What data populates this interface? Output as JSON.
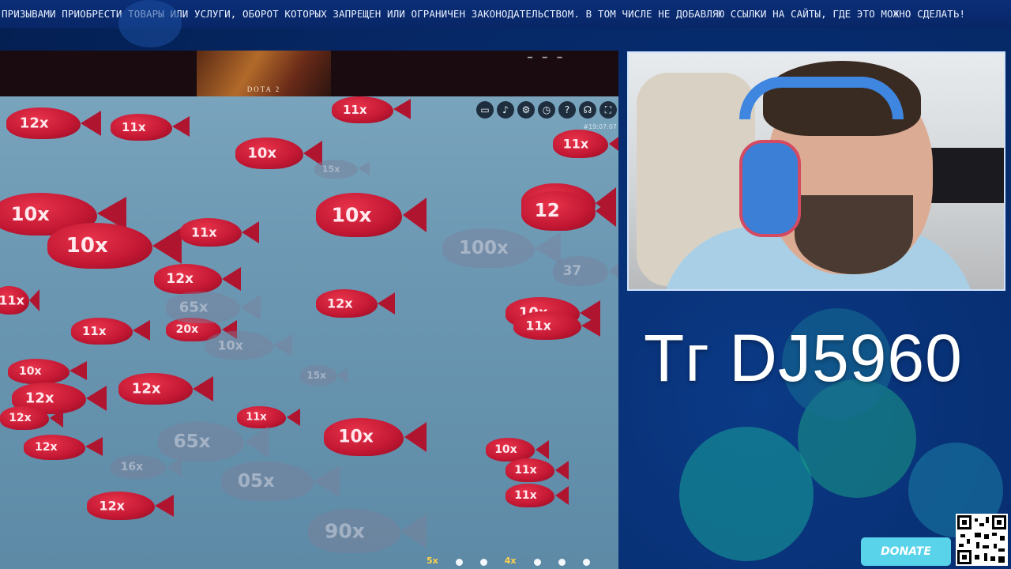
{
  "ticker": {
    "text": "ПРИЗЫВАМИ ПРИОБРЕСТИ ТОВАРЫ ИЛИ УСЛУГИ, ОБОРОТ КОТОРЫХ ЗАПРЕЩЕН ИЛИ ОГРАНИЧЕН ЗАКОНОДАТЕЛЬСТВОМ. В ТОМ ЧИСЛЕ НЕ ДОБАВЛЯЮ ССЫЛКИ НА САЙТЫ, ГДЕ ЭТО МОЖНО СДЕЛАТЬ!"
  },
  "game": {
    "banner_label": "DOTA 2",
    "toolbar": [
      {
        "name": "chat-icon",
        "glyph": "▭"
      },
      {
        "name": "sound-icon",
        "glyph": "♪"
      },
      {
        "name": "settings-icon",
        "glyph": "⚙"
      },
      {
        "name": "history-icon",
        "glyph": "◷"
      },
      {
        "name": "help-icon",
        "glyph": "?"
      },
      {
        "name": "support-icon",
        "glyph": "☊"
      },
      {
        "name": "fullscreen-icon",
        "glyph": "⛶"
      }
    ],
    "clock": "#19:07:07",
    "fish_labels": [
      "12x",
      "11x",
      "11x",
      "10x",
      "15x",
      "11x",
      "10x",
      "10x",
      "11x",
      "10x",
      "10x",
      "12x",
      "12x",
      "11x",
      "11x",
      "20x",
      "10x",
      "10x",
      "12x",
      "12x",
      "10x",
      "11x",
      "12x",
      "16x",
      "10x",
      "12x",
      "11x",
      "10x",
      "12x",
      "11x",
      "11x",
      "12",
      "100x",
      "65x",
      "37",
      "65x",
      "05x",
      "90x",
      "15x"
    ],
    "bottom_multipliers": [
      "5x",
      "4x"
    ]
  },
  "overlay": {
    "handle": "Tг DJ5960",
    "donate_label": "DONATE"
  }
}
